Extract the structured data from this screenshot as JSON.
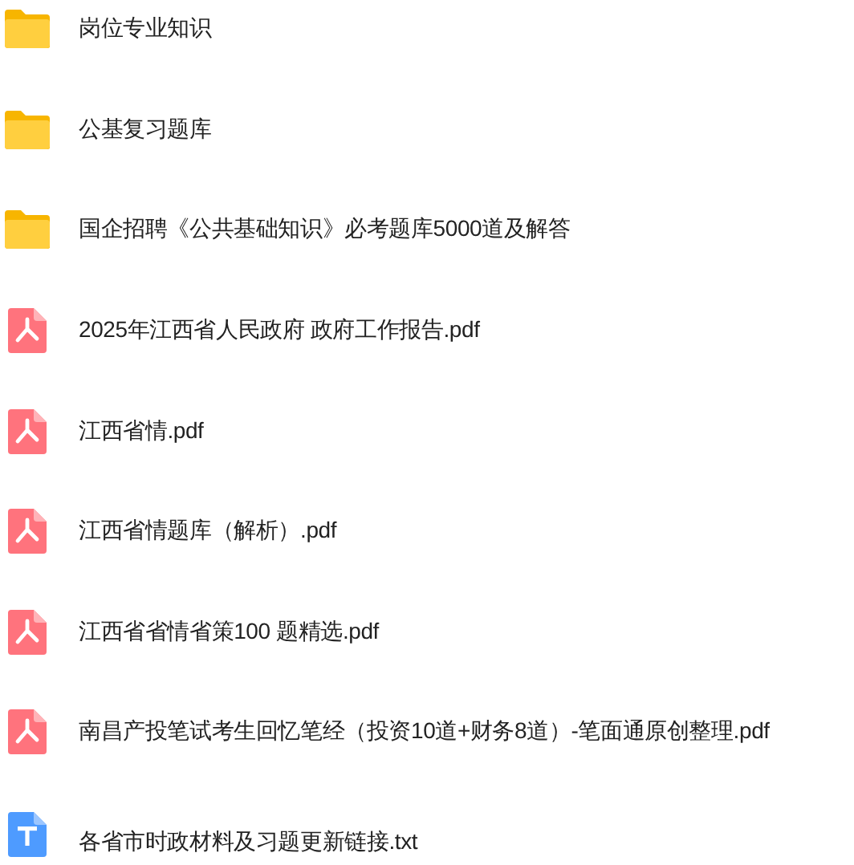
{
  "files": [
    {
      "kind": "folder",
      "name": "岗位专业知识"
    },
    {
      "kind": "folder",
      "name": "公基复习题库"
    },
    {
      "kind": "folder",
      "name": "国企招聘《公共基础知识》必考题库5000道及解答"
    },
    {
      "kind": "pdf",
      "name": "2025年江西省人民政府 政府工作报告.pdf"
    },
    {
      "kind": "pdf",
      "name": "江西省情.pdf"
    },
    {
      "kind": "pdf",
      "name": "江西省情题库（解析）.pdf"
    },
    {
      "kind": "pdf",
      "name": "江西省省情省策100 题精选.pdf"
    },
    {
      "kind": "pdf",
      "name": "南昌产投笔试考生回忆笔经（投资10道+财务8道）-笔面通原创整理.pdf"
    },
    {
      "kind": "txt",
      "name": "各省市时政材料及习题更新链接.txt"
    }
  ]
}
